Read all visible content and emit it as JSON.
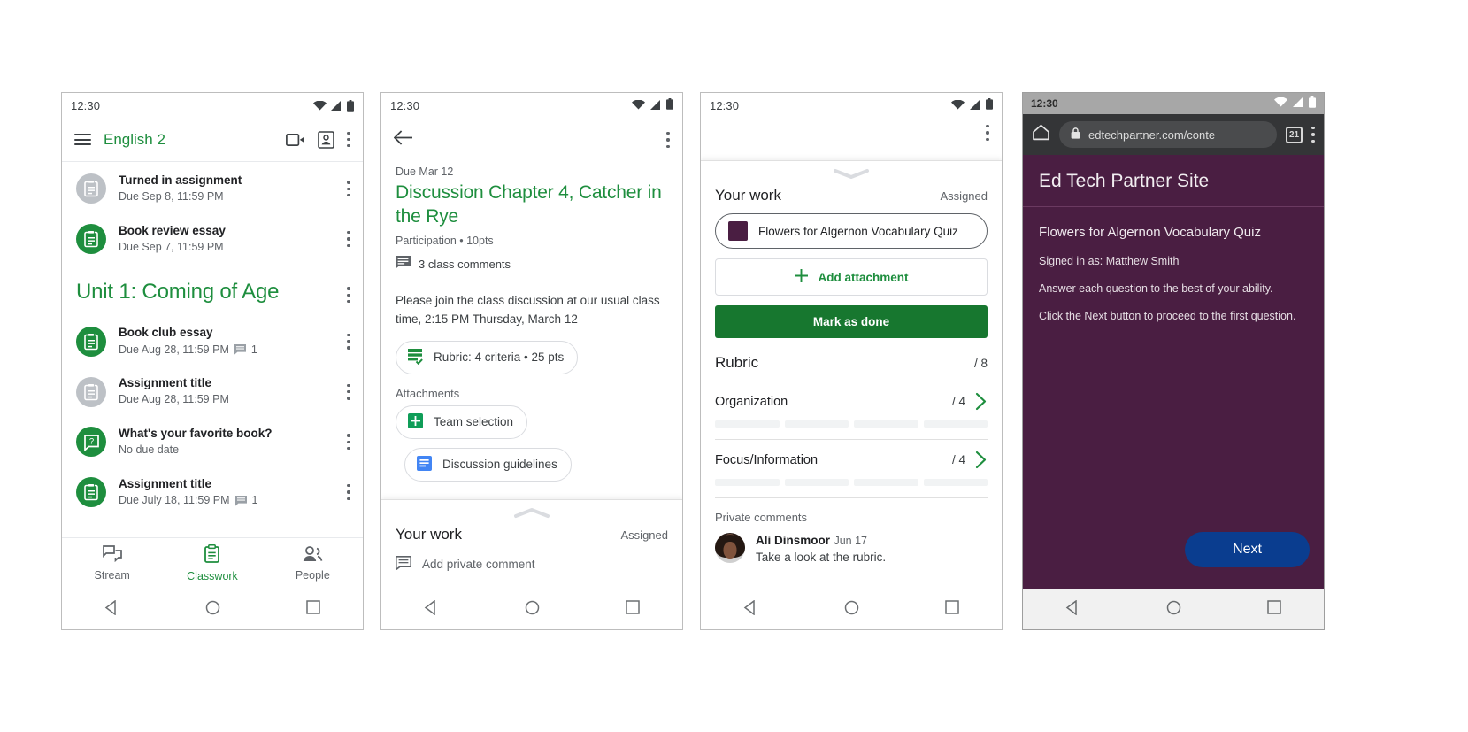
{
  "status_time": "12:30",
  "phone1": {
    "appbar": {
      "title": "English 2",
      "menu_icon": "hamburger-icon",
      "meet_icon": "video-camera-icon",
      "card_icon": "class-card-icon",
      "overflow_icon": "more-vert-icon"
    },
    "items_top": [
      {
        "title": "Turned in assignment",
        "sub": "Due Sep 8, 11:59 PM",
        "icon": "assignment-icon",
        "state": "gray",
        "comments": ""
      },
      {
        "title": "Book review essay",
        "sub": "Due Sep 7, 11:59 PM",
        "icon": "assignment-icon",
        "state": "green",
        "comments": ""
      }
    ],
    "topic": "Unit 1: Coming of Age",
    "items_topic": [
      {
        "title": "Book club essay",
        "sub": "Due Aug 28, 11:59 PM",
        "icon": "assignment-icon",
        "state": "green",
        "comments": "1"
      },
      {
        "title": "Assignment title",
        "sub": "Due Aug 28, 11:59 PM",
        "icon": "assignment-icon",
        "state": "gray",
        "comments": ""
      },
      {
        "title": "What's your favorite book?",
        "sub": "No due date",
        "icon": "question-icon",
        "state": "green",
        "comments": ""
      },
      {
        "title": "Assignment title",
        "sub": "Due July 18, 11:59 PM",
        "icon": "assignment-icon",
        "state": "green",
        "comments": "1"
      }
    ],
    "bottomnav": [
      {
        "label": "Stream",
        "icon": "stream-icon",
        "active": false
      },
      {
        "label": "Classwork",
        "icon": "classwork-icon",
        "active": true
      },
      {
        "label": "People",
        "icon": "people-icon",
        "active": false
      }
    ]
  },
  "phone2": {
    "back_icon": "back-arrow-icon",
    "overflow_icon": "more-vert-icon",
    "due": "Due Mar 12",
    "title": "Discussion Chapter 4, Catcher in the Rye",
    "meta": "Participation • 10pts",
    "comments": "3 class comments",
    "comments_icon": "comment-icon",
    "description": "Please join the class discussion at our usual class time, 2:15 PM Thursday, March 12",
    "rubric_chip": "Rubric: 4 criteria • 25 pts",
    "rubric_chip_icon": "rubric-icon",
    "attachments_label": "Attachments",
    "attachments": [
      {
        "label": "Team selection",
        "icon": "google-sheets-icon"
      },
      {
        "label": "Discussion guidelines",
        "icon": "google-docs-icon"
      }
    ],
    "your_work": {
      "title": "Your work",
      "status": "Assigned",
      "comment_placeholder": "Add private comment",
      "comment_icon": "comment-icon",
      "handle_icon": "chevron-up-icon"
    }
  },
  "phone3": {
    "overflow_icon": "more-vert-icon",
    "handle_icon": "chevron-down-icon",
    "your_work": {
      "title": "Your work",
      "status": "Assigned"
    },
    "attachment": {
      "label": "Flowers for Algernon Vocabulary Quiz",
      "icon": "quiz-thumbnail-icon"
    },
    "add_attachment": {
      "label": "Add attachment",
      "icon": "plus-icon"
    },
    "mark_done": "Mark as done",
    "rubric": {
      "title": "Rubric",
      "total": "/ 8",
      "criteria": [
        {
          "name": "Organization",
          "score": "/ 4",
          "chevron": "chevron-right-icon"
        },
        {
          "name": "Focus/Information",
          "score": "/ 4",
          "chevron": "chevron-right-icon"
        }
      ]
    },
    "private_comments": {
      "label": "Private comments",
      "comment": {
        "author": "Ali Dinsmoor",
        "date": "Jun 17",
        "text": "Take a look at the rubric.",
        "avatar": "user-avatar"
      }
    }
  },
  "phone4": {
    "browser": {
      "home_icon": "home-icon",
      "lock_icon": "lock-icon",
      "url": "edtechpartner.com/conte",
      "tab_count": "21",
      "overflow_icon": "more-vert-icon"
    },
    "site_header": "Ed Tech Partner Site",
    "quiz_title": "Flowers for Algernon Vocabulary Quiz",
    "lines": [
      "Signed in as: Matthew Smith",
      "Answer each question to the best of your ability.",
      "Click the Next button to proceed to the first question."
    ],
    "next_button": "Next"
  },
  "colors": {
    "classroom_green": "#1e8e3e",
    "dark_green": "#17772f",
    "quiz_purple": "#4a1e42",
    "next_blue": "#0a3d8f",
    "docs_blue": "#4285f4",
    "sheets_green": "#0f9d58"
  }
}
